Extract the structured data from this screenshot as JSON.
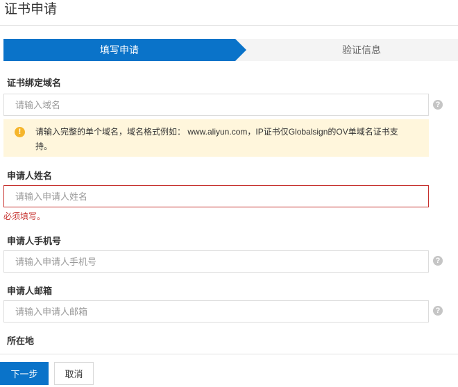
{
  "page": {
    "title": "证书申请"
  },
  "steps": [
    {
      "label": "填写申请",
      "active": true
    },
    {
      "label": "验证信息",
      "active": false
    }
  ],
  "fields": {
    "domain": {
      "label": "证书绑定域名",
      "placeholder": "请输入域名",
      "value": ""
    },
    "name": {
      "label": "申请人姓名",
      "placeholder": "请输入申请人姓名",
      "value": "",
      "error": "必须填写。"
    },
    "phone": {
      "label": "申请人手机号",
      "placeholder": "请输入申请人手机号",
      "value": ""
    },
    "email": {
      "label": "申请人邮箱",
      "placeholder": "请输入申请人邮箱",
      "value": ""
    },
    "location": {
      "label": "所在地"
    }
  },
  "notice": {
    "text": "请输入完整的单个域名，域名格式例如： www.aliyun.com，IP证书仅Globalsign的OV单域名证书支持。",
    "icon": "warning-icon"
  },
  "help_icon_glyph": "?",
  "notice_icon_glyph": "!",
  "buttons": {
    "next": "下一步",
    "cancel": "取消"
  },
  "colors": {
    "primary": "#0a73c9",
    "error": "#c6302d",
    "notice_bg": "#fff6dc",
    "warning": "#f5b52b"
  }
}
